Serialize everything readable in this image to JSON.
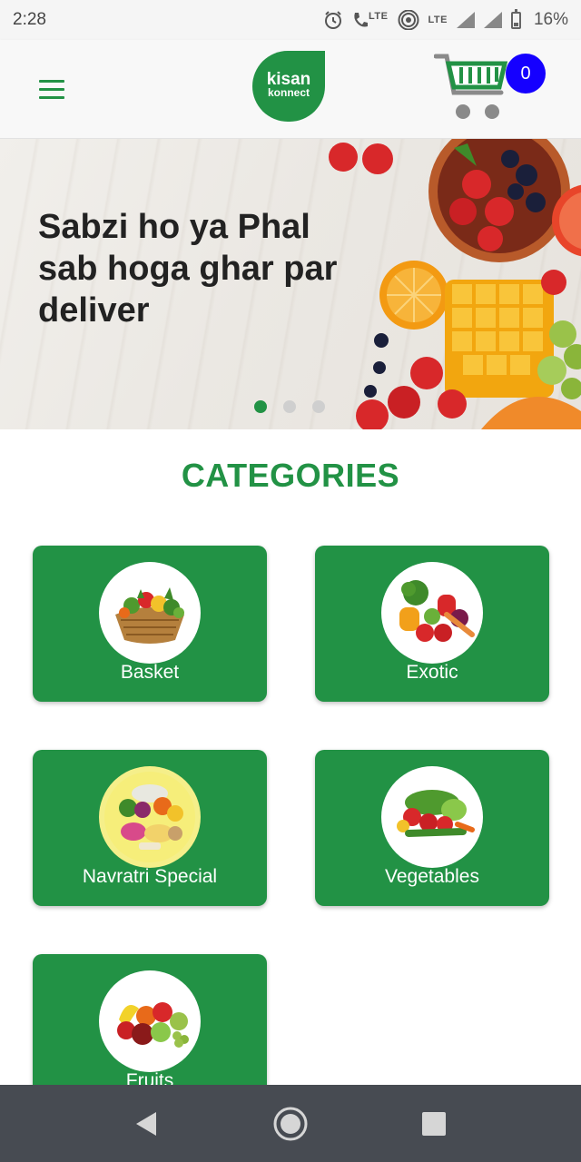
{
  "status_bar": {
    "time": "2:28",
    "lte1": "LTE",
    "lte2": "LTE",
    "battery": "16%"
  },
  "header": {
    "logo_line1": "kisan",
    "logo_line2": "konnect",
    "cart_count": "0"
  },
  "banner": {
    "line1": "Sabzi ho ya Phal",
    "line2": "sab hoga ghar par",
    "line3": "deliver",
    "active_slide": 1,
    "slide_count": 3
  },
  "categories": {
    "title": "CATEGORIES",
    "items": [
      {
        "label": "Basket"
      },
      {
        "label": "Exotic"
      },
      {
        "label": "Navratri Special"
      },
      {
        "label": "Vegetables"
      },
      {
        "label": "Fruits"
      }
    ]
  },
  "colors": {
    "brand_green": "#229245",
    "badge_blue": "#1500ff",
    "nav_bar": "#474b52"
  }
}
